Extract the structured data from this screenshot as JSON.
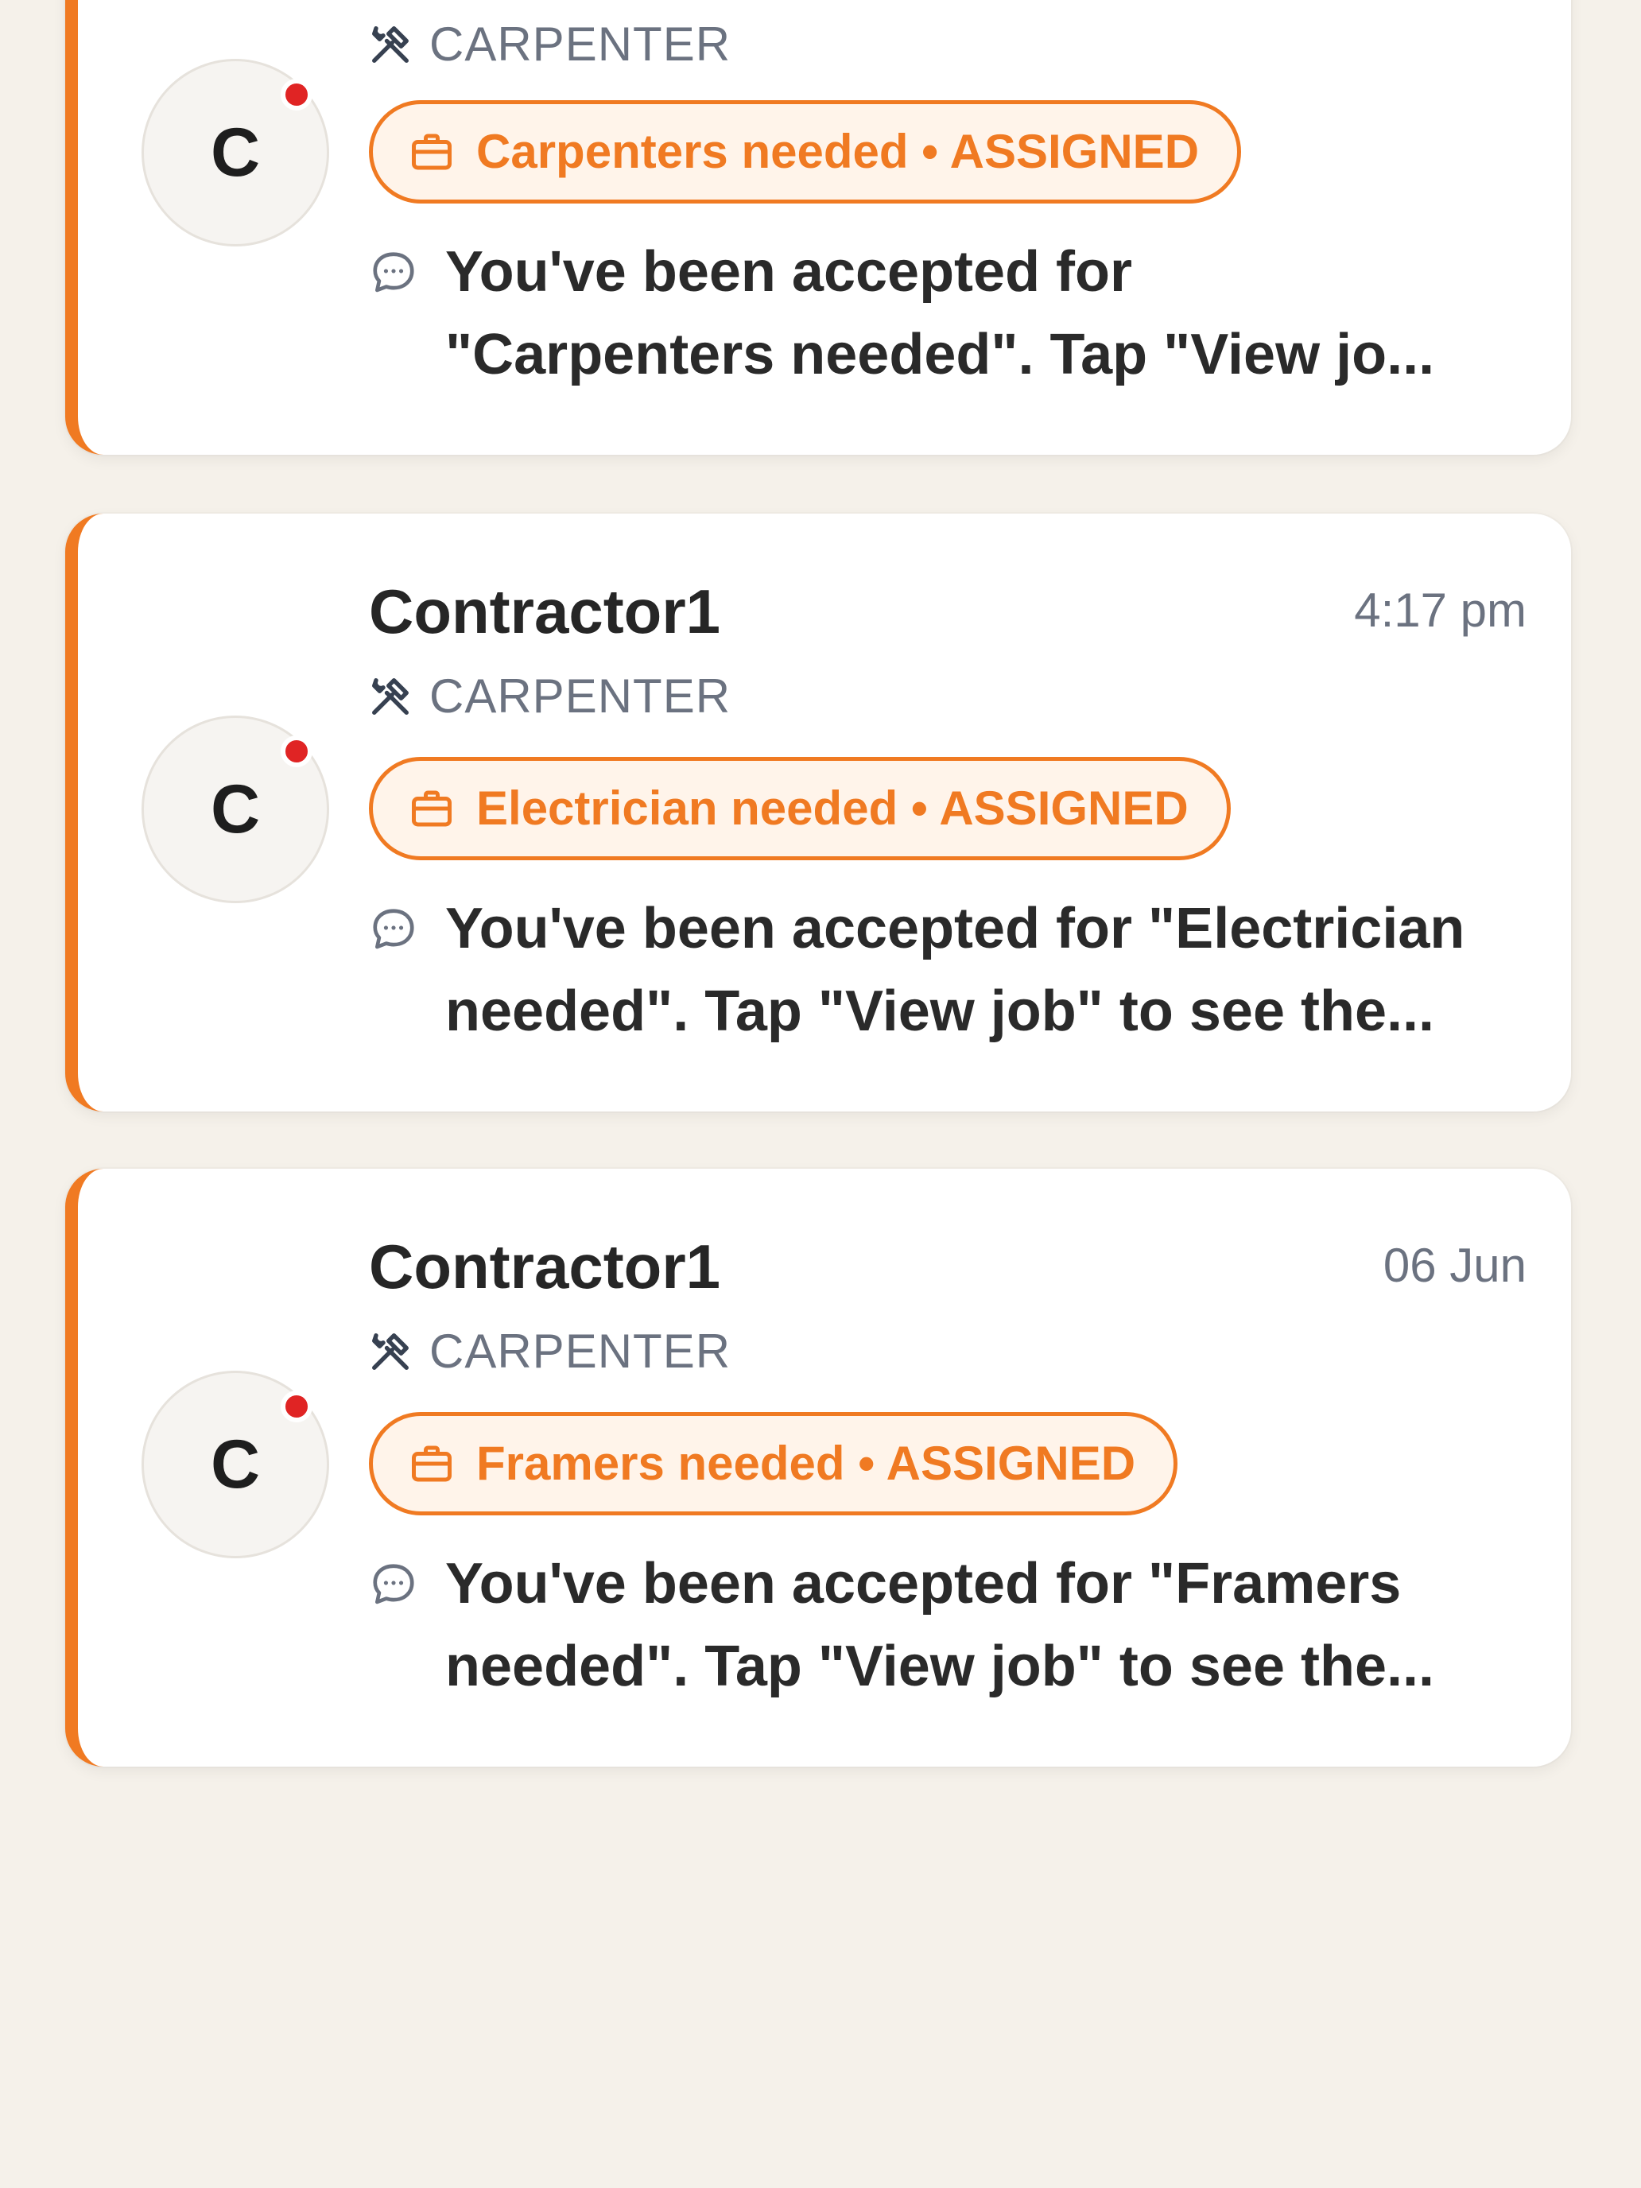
{
  "notifications": [
    {
      "sender": "",
      "time": "",
      "avatar_letter": "C",
      "role": "CARPENTER",
      "job_pill": "Carpenters needed • ASSIGNED",
      "message_line1": "You've been accepted for",
      "message_line2": "\"Carpenters needed\". Tap \"View jo..."
    },
    {
      "sender": "Contractor1",
      "time": "4:17 pm",
      "avatar_letter": "C",
      "role": "CARPENTER",
      "job_pill": "Electrician needed • ASSIGNED",
      "message_line1": "You've been accepted for \"Electrician",
      "message_line2": "needed\". Tap \"View job\" to see the..."
    },
    {
      "sender": "Contractor1",
      "time": "06 Jun",
      "avatar_letter": "C",
      "role": "CARPENTER",
      "job_pill": "Framers needed • ASSIGNED",
      "message_line1": "You've been accepted for \"Framers",
      "message_line2": "needed\". Tap \"View job\" to see the..."
    }
  ],
  "icons": {
    "role": "hammer-wrench-icon",
    "job": "briefcase-icon",
    "message": "chat-bubble-icon"
  },
  "colors": {
    "accent": "#F07A22",
    "unread": "#E02424",
    "background": "#F5F1EA"
  }
}
